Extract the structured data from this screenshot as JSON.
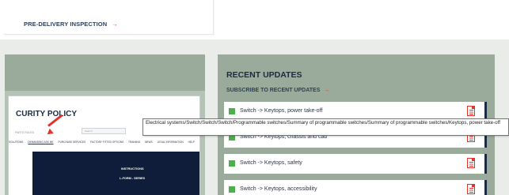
{
  "top": {
    "pdi_link": "PRE-DELIVERY INSPECTION",
    "pdi_arrow": "→"
  },
  "screenshot_preview": {
    "title": "CURITY POLICY",
    "subtitle": "PARTS RULES",
    "search_placeholder": "Search",
    "nav": [
      "SOLUTIONS",
      "DEMANDING ASK ME",
      "PURCHASE SERVICES",
      "FACTORY FITTED OPTIONS",
      "TRAINING",
      "NEWS",
      "LEGAL INFORMATION",
      "HELP"
    ],
    "hero_line1": "INSTRUCTIONS",
    "hero_line2": "L-FORM - SERIES"
  },
  "recent_updates": {
    "title": "RECENT UPDATES",
    "subscribe": "SUBSCRIBE TO RECENT UPDATES",
    "subscribe_arrow": "→",
    "items": [
      {
        "label": "Switch -> Keytops, power take-off"
      },
      {
        "label": "Switch -> Keytops, chassis and cab"
      },
      {
        "label": "Switch -> Keytops, safety"
      },
      {
        "label": "Switch -> Keytops, accessibility"
      }
    ]
  },
  "tooltip": {
    "text": "Electrical systems/Switch/Switch/Switch/Programmable switches/Summary of programmable switches/Summary of programmable switches/Keytops, power take-off"
  },
  "colors": {
    "accent_red": "#e2332b",
    "panel_green": "#9aab9c",
    "navy": "#1b2a43",
    "status_green": "#4cae4c"
  }
}
